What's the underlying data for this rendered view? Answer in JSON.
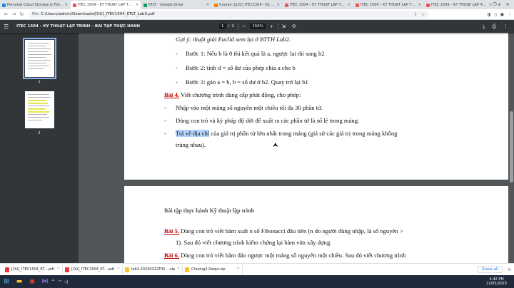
{
  "tabs": [
    {
      "title": "Personal Cloud Storage & File S...",
      "favicon_color": "#1e88e5",
      "active": false
    },
    {
      "title": "ITEC 1504 - KỸ THUẬT LẬP TRÌN...",
      "favicon_color": "#ef5350",
      "active": true
    },
    {
      "title": "KTLT - Google Drive",
      "favicon_color": "#0f9d58",
      "active": false
    },
    {
      "title": "Course: [222] ITEC1504 - Kỹ thuậ...",
      "favicon_color": "#f57c00",
      "active": false
    },
    {
      "title": "ITEC 1504 – KỸ THUẬT LẬP TRÌN...",
      "favicon_color": "#ef5350",
      "active": false
    },
    {
      "title": "ITEC 1504 – KỸ THUẬT LẬP TRÌN...",
      "favicon_color": "#ef5350",
      "active": false
    },
    {
      "title": "ITEC 1504 – KỸ THUẬT LẬP TRÌN...",
      "favicon_color": "#ef5350",
      "active": false
    }
  ],
  "address": {
    "scheme": "File",
    "url": "C:/Users/admin/Downloads/[OU]_ITEC1504_KTLT_Lab3.pdf"
  },
  "pdf": {
    "title": "ITEC 1504 – KỸ THUẬT LẬP TRÌNH – BÀI TẬP THỰC HÀNH",
    "page_current": "1",
    "page_sep": "/",
    "page_total": "2",
    "zoom": "156%",
    "thumb_numbers": [
      "1",
      "2"
    ]
  },
  "doc": {
    "hint": "Gợi ý: thuật giải Euclid xem lại ở BTTH Lab2.",
    "steps": [
      "Bước 1: Nếu b là 0 thì kết quả là a, ngược lại thì sang b2",
      "Bước 2: tính d = số dư của phép chia a cho b",
      "Bước 3: gán a = b, b = số  dư ở b2. Quay trở lại b1"
    ],
    "bai4_label": "Bài 4.",
    "bai4_text": " Viết chương trình dùng cấp phát động, cho phép:",
    "bullets": [
      "Nhập vào một mảng số nguyên một chiều tối đa 30 phần tử.",
      "Dùng con trỏ và ký pháp độ dời để xuất ra các phần tử là số lẻ trong mảng."
    ],
    "bullet3_selected": "Trả về địa chỉ",
    "bullet3_rest": " của giá trị phần tử lớn nhất trong mảng (giả sử các giá trị trong mảng không",
    "bullet3_cont": "trùng nhau).",
    "page2_header": "Bài tập thực hành Kỹ thuật lập trình",
    "bai5_label": "Bài 5.",
    "bai5_text": " Dùng con trỏ viết hàm xuất n số Fibonacci đầu tiên (n do người dùng nhập, là số nguyên >",
    "bai5_cont": "1). Sau đó viết chương trình kiểm chứng lại hàm vừa xây dựng.",
    "bai6_label": "Bài 6.",
    "bai6_text": " Dùng con trỏ viết hàm đảo ngược một mảng số nguyên một chiều. Sau đó viết chương trình"
  },
  "downloads": [
    {
      "name": "[OU]_ITEC1504_KT....pdf",
      "icon_color": "#e53935"
    },
    {
      "name": "[OU]_ITEC1504_KT....pdf",
      "icon_color": "#e53935"
    },
    {
      "name": "lab3-20230322T05....zip",
      "icon_color": "#fbc02d"
    },
    {
      "name": "Chuong2-Dequi.zip",
      "icon_color": "#fbc02d"
    }
  ],
  "show_all": "Show all",
  "clock": {
    "time": "4:42 PM",
    "date": "22/03/2023"
  }
}
